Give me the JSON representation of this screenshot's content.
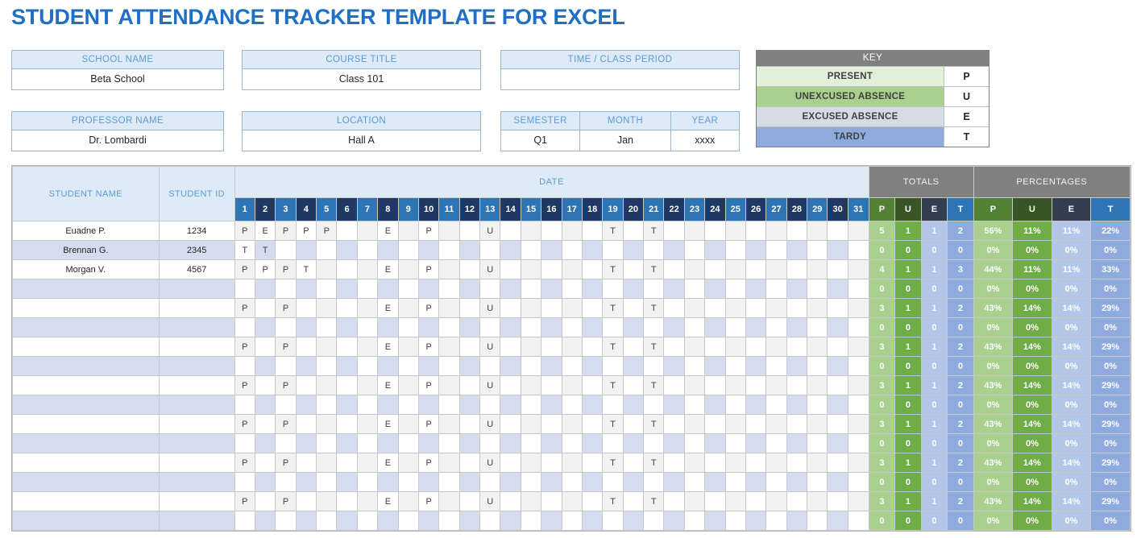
{
  "title": "STUDENT ATTENDANCE TRACKER TEMPLATE FOR EXCEL",
  "info": {
    "school_name": {
      "label": "SCHOOL NAME",
      "value": "Beta School"
    },
    "course_title": {
      "label": "COURSE TITLE",
      "value": "Class 101"
    },
    "time_class_period": {
      "label": "TIME / CLASS PERIOD",
      "value": ""
    },
    "professor_name": {
      "label": "PROFESSOR NAME",
      "value": "Dr. Lombardi"
    },
    "location": {
      "label": "LOCATION",
      "value": "Hall A"
    },
    "semester": {
      "label": "SEMESTER",
      "value": "Q1"
    },
    "month": {
      "label": "MONTH",
      "value": "Jan"
    },
    "year": {
      "label": "YEAR",
      "value": "xxxx"
    }
  },
  "key": {
    "title": "KEY",
    "rows": [
      {
        "label": "PRESENT",
        "code": "P",
        "color": "#E2EFDA"
      },
      {
        "label": "UNEXCUSED ABSENCE",
        "code": "U",
        "color": "#A9D08E"
      },
      {
        "label": "EXCUSED ABSENCE",
        "code": "E",
        "color": "#D6DCE5"
      },
      {
        "label": "TARDY",
        "code": "T",
        "color": "#8FAADC"
      }
    ]
  },
  "table": {
    "headers": {
      "student_name": "STUDENT NAME",
      "student_id": "STUDENT ID",
      "date": "DATE",
      "totals": "TOTALS",
      "percentages": "PERCENTAGES"
    },
    "days": [
      1,
      2,
      3,
      4,
      5,
      6,
      7,
      8,
      9,
      10,
      11,
      12,
      13,
      14,
      15,
      16,
      17,
      18,
      19,
      20,
      21,
      22,
      23,
      24,
      25,
      26,
      27,
      28,
      29,
      30,
      31
    ],
    "sub_headers": {
      "totals": [
        "P",
        "U",
        "E",
        "T"
      ],
      "percentages": [
        "P",
        "U",
        "E",
        "T"
      ]
    },
    "rows": [
      {
        "name": "Euadne P.",
        "id": "1234",
        "marks": {
          "1": "P",
          "2": "E",
          "3": "P",
          "4": "P",
          "5": "P",
          "8": "E",
          "10": "P",
          "13": "U",
          "19": "T",
          "21": "T"
        },
        "totals": [
          "5",
          "1",
          "1",
          "2"
        ],
        "percentages": [
          "56%",
          "11%",
          "11%",
          "22%"
        ]
      },
      {
        "name": "Brennan G.",
        "id": "2345",
        "marks": {
          "1": "T",
          "2": "T"
        },
        "totals": [
          "0",
          "0",
          "0",
          "0"
        ],
        "percentages": [
          "0%",
          "0%",
          "0%",
          "0%"
        ]
      },
      {
        "name": "Morgan V.",
        "id": "4567",
        "marks": {
          "1": "P",
          "2": "P",
          "3": "P",
          "4": "T",
          "8": "E",
          "10": "P",
          "13": "U",
          "19": "T",
          "21": "T"
        },
        "totals": [
          "4",
          "1",
          "1",
          "3"
        ],
        "percentages": [
          "44%",
          "11%",
          "11%",
          "33%"
        ]
      },
      {
        "name": "",
        "id": "",
        "marks": {},
        "totals": [
          "0",
          "0",
          "0",
          "0"
        ],
        "percentages": [
          "0%",
          "0%",
          "0%",
          "0%"
        ]
      },
      {
        "name": "",
        "id": "",
        "marks": {
          "1": "P",
          "3": "P",
          "8": "E",
          "10": "P",
          "13": "U",
          "19": "T",
          "21": "T"
        },
        "totals": [
          "3",
          "1",
          "1",
          "2"
        ],
        "percentages": [
          "43%",
          "14%",
          "14%",
          "29%"
        ]
      },
      {
        "name": "",
        "id": "",
        "marks": {},
        "totals": [
          "0",
          "0",
          "0",
          "0"
        ],
        "percentages": [
          "0%",
          "0%",
          "0%",
          "0%"
        ]
      },
      {
        "name": "",
        "id": "",
        "marks": {
          "1": "P",
          "3": "P",
          "8": "E",
          "10": "P",
          "13": "U",
          "19": "T",
          "21": "T"
        },
        "totals": [
          "3",
          "1",
          "1",
          "2"
        ],
        "percentages": [
          "43%",
          "14%",
          "14%",
          "29%"
        ]
      },
      {
        "name": "",
        "id": "",
        "marks": {},
        "totals": [
          "0",
          "0",
          "0",
          "0"
        ],
        "percentages": [
          "0%",
          "0%",
          "0%",
          "0%"
        ]
      },
      {
        "name": "",
        "id": "",
        "marks": {
          "1": "P",
          "3": "P",
          "8": "E",
          "10": "P",
          "13": "U",
          "19": "T",
          "21": "T"
        },
        "totals": [
          "3",
          "1",
          "1",
          "2"
        ],
        "percentages": [
          "43%",
          "14%",
          "14%",
          "29%"
        ]
      },
      {
        "name": "",
        "id": "",
        "marks": {},
        "totals": [
          "0",
          "0",
          "0",
          "0"
        ],
        "percentages": [
          "0%",
          "0%",
          "0%",
          "0%"
        ]
      },
      {
        "name": "",
        "id": "",
        "marks": {
          "1": "P",
          "3": "P",
          "8": "E",
          "10": "P",
          "13": "U",
          "19": "T",
          "21": "T"
        },
        "totals": [
          "3",
          "1",
          "1",
          "2"
        ],
        "percentages": [
          "43%",
          "14%",
          "14%",
          "29%"
        ]
      },
      {
        "name": "",
        "id": "",
        "marks": {},
        "totals": [
          "0",
          "0",
          "0",
          "0"
        ],
        "percentages": [
          "0%",
          "0%",
          "0%",
          "0%"
        ]
      },
      {
        "name": "",
        "id": "",
        "marks": {
          "1": "P",
          "3": "P",
          "8": "E",
          "10": "P",
          "13": "U",
          "19": "T",
          "21": "T"
        },
        "totals": [
          "3",
          "1",
          "1",
          "2"
        ],
        "percentages": [
          "43%",
          "14%",
          "14%",
          "29%"
        ]
      },
      {
        "name": "",
        "id": "",
        "marks": {},
        "totals": [
          "0",
          "0",
          "0",
          "0"
        ],
        "percentages": [
          "0%",
          "0%",
          "0%",
          "0%"
        ]
      },
      {
        "name": "",
        "id": "",
        "marks": {
          "1": "P",
          "3": "P",
          "8": "E",
          "10": "P",
          "13": "U",
          "19": "T",
          "21": "T"
        },
        "totals": [
          "3",
          "1",
          "1",
          "2"
        ],
        "percentages": [
          "43%",
          "14%",
          "14%",
          "29%"
        ]
      },
      {
        "name": "",
        "id": "",
        "marks": {},
        "totals": [
          "0",
          "0",
          "0",
          "0"
        ],
        "percentages": [
          "0%",
          "0%",
          "0%",
          "0%"
        ]
      }
    ]
  },
  "colors": {
    "title": "#1F6FC4",
    "header_fill": "#DEEAF6",
    "header_text": "#5B9BD5",
    "day_odd": "#2E75B6",
    "day_even": "#1F3864",
    "gray_band": "#808080",
    "total_p": "#548235",
    "total_u": "#375623",
    "total_e": "#333F50",
    "total_t": "#2E75B6",
    "cell_p": "#A9D08E",
    "cell_u": "#70AD47",
    "cell_e": "#B4C6E7",
    "cell_t": "#8FAADC",
    "row_alt": "#D6DCEF"
  }
}
